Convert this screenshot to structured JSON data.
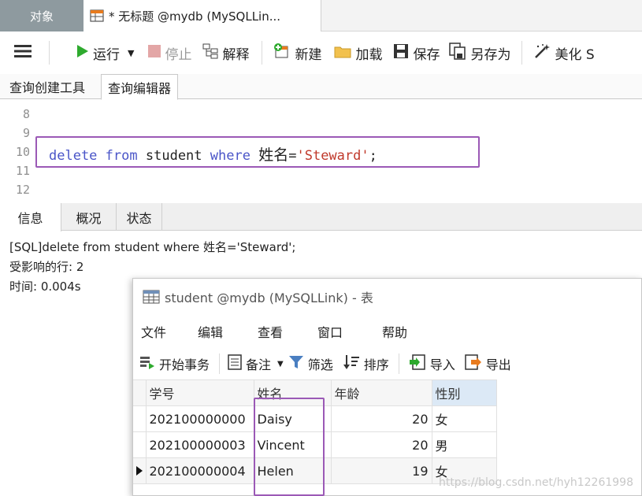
{
  "tabs": {
    "objects": "对象",
    "query": "* 无标题 @mydb (MySQLLin..."
  },
  "toolbar": {
    "run": "运行",
    "stop": "停止",
    "explain": "解释",
    "new": "新建",
    "load": "加载",
    "save": "保存",
    "save_as": "另存为",
    "beautify": "美化 S"
  },
  "subtabs": {
    "builder": "查询创建工具",
    "editor": "查询编辑器"
  },
  "editor": {
    "line_numbers": [
      "8",
      "9",
      "10",
      "11",
      "12"
    ],
    "kw_delete": "delete",
    "kw_from": "from",
    "table_name": "student",
    "kw_where": "where",
    "field": "姓名",
    "eq": "=",
    "value": "'Steward'",
    "semicolon": ";"
  },
  "info_tabs": {
    "info": "信息",
    "overview": "概况",
    "status": "状态"
  },
  "info": {
    "sql": "[SQL]delete from student where 姓名='Steward';",
    "affected": "受影响的行: 2",
    "time": "时间: 0.004s"
  },
  "window": {
    "title": "student @mydb (MySQLLink) - 表",
    "menu": [
      "文件",
      "编辑",
      "查看",
      "窗口",
      "帮助"
    ],
    "toolbar": {
      "begin_tx": "开始事务",
      "note": "备注",
      "filter": "筛选",
      "sort": "排序",
      "import": "导入",
      "export": "导出"
    },
    "columns": [
      "学号",
      "姓名",
      "年龄",
      "性别"
    ],
    "rows": [
      {
        "id": "202100000000",
        "name": "Daisy",
        "age": "20",
        "gender": "女"
      },
      {
        "id": "202100000003",
        "name": "Vincent",
        "age": "20",
        "gender": "男"
      },
      {
        "id": "202100000004",
        "name": "Helen",
        "age": "19",
        "gender": "女"
      }
    ],
    "watermark": "https://blog.csdn.net/hyh12261998"
  },
  "colors": {
    "highlight_box": "#9b59b6",
    "keyword": "#4a55c8",
    "string": "#c0392b",
    "run_green": "#2eaa2e"
  }
}
